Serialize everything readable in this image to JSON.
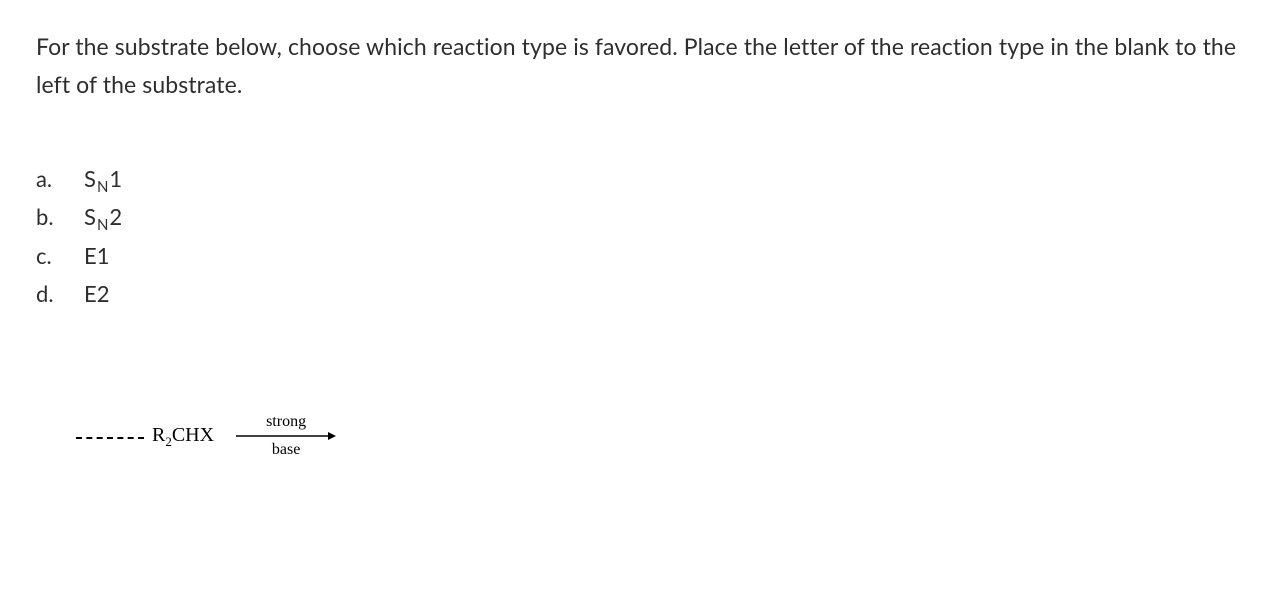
{
  "question": {
    "prompt": "For the substrate below, choose which reaction type is favored. Place the letter of the reaction type in the blank to the left of the substrate."
  },
  "options": {
    "a": {
      "label": "a.",
      "prefix": "S",
      "sub": "N",
      "suffix": "1"
    },
    "b": {
      "label": "b.",
      "prefix": "S",
      "sub": "N",
      "suffix": "2"
    },
    "c": {
      "label": "c.",
      "text": "E1"
    },
    "d": {
      "label": "d.",
      "text": "E2"
    }
  },
  "reaction": {
    "substrate": {
      "r": "R",
      "sub": "2",
      "rest": "CHX"
    },
    "condition_top": "strong",
    "condition_bottom": "base"
  }
}
